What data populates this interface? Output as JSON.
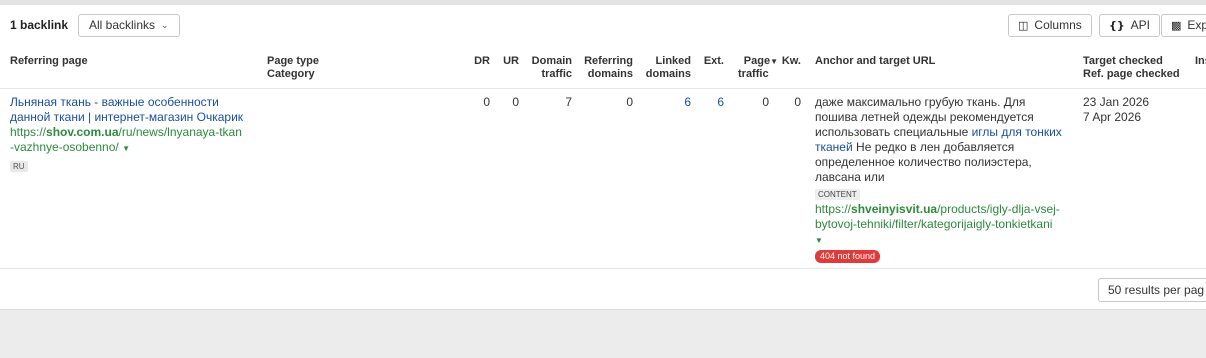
{
  "toolbar": {
    "count": "1 backlink",
    "filter": "All backlinks",
    "columns": "Columns",
    "api": "API",
    "export": "Exp"
  },
  "headers": {
    "referring_page": "Referring page",
    "page_type": "Page type",
    "category": "Category",
    "dr": "DR",
    "ur": "UR",
    "domain_traffic_1": "Domain",
    "domain_traffic_2": "traffic",
    "referring_domains_1": "Referring",
    "referring_domains_2": "domains",
    "linked_domains_1": "Linked",
    "linked_domains_2": "domains",
    "ext": "Ext.",
    "page_traffic_1": "Page",
    "page_traffic_2": "traffic",
    "kw": "Kw.",
    "anchor": "Anchor and target URL",
    "target_checked": "Target checked",
    "ref_checked": "Ref. page checked",
    "ins": "Ins"
  },
  "row": {
    "title_1": "Льняная ткань - важные особенности",
    "title_2": "данной ткани | интернет-магазин Очкарик",
    "url_prefix": "https://",
    "url_domain": "shov.com.ua",
    "url_path_1": "/ru/news/lnyanaya-tkan",
    "url_path_2": "-vazhnye-osobenno/",
    "lang": "RU",
    "dr": "0",
    "ur": "0",
    "domain_traffic": "7",
    "referring_domains": "0",
    "linked_domains": "6",
    "ext": "6",
    "page_traffic": "0",
    "kw": "0",
    "anchor_1": "даже максимально грубую ткань. Для",
    "anchor_2": "пошива летней одежды рекомендуется",
    "anchor_3a": "использовать специальные ",
    "anchor_3b": "иглы для тонких",
    "anchor_4a": "тканей",
    "anchor_4b": " Не редко в лен добавляется",
    "anchor_5": "определенное количество полиэстера,",
    "anchor_6": "лавсана или",
    "content_badge": "CONTENT",
    "target_prefix": "https://",
    "target_domain": "shveinyisvit.ua",
    "target_path_1": "/products/igly-dlja-vsej-",
    "target_path_2": "bytovoj-tehniki/filter/kategorijaigly-tonkietkani",
    "status": "404 not found",
    "target_checked": "23 Jan 2026",
    "ref_checked": "7 Apr 2026"
  },
  "pagination": {
    "per_page": "50 results per pag"
  },
  "icons": {
    "columns": "columns-icon",
    "api": "braces-icon",
    "export": "export-icon",
    "dropdown": "chevron-down-icon",
    "sort": "sort-desc-icon"
  },
  "colors": {
    "link": "#1a4fa0",
    "url_green": "#2d8a3e",
    "error_badge": "#e03a3a"
  }
}
